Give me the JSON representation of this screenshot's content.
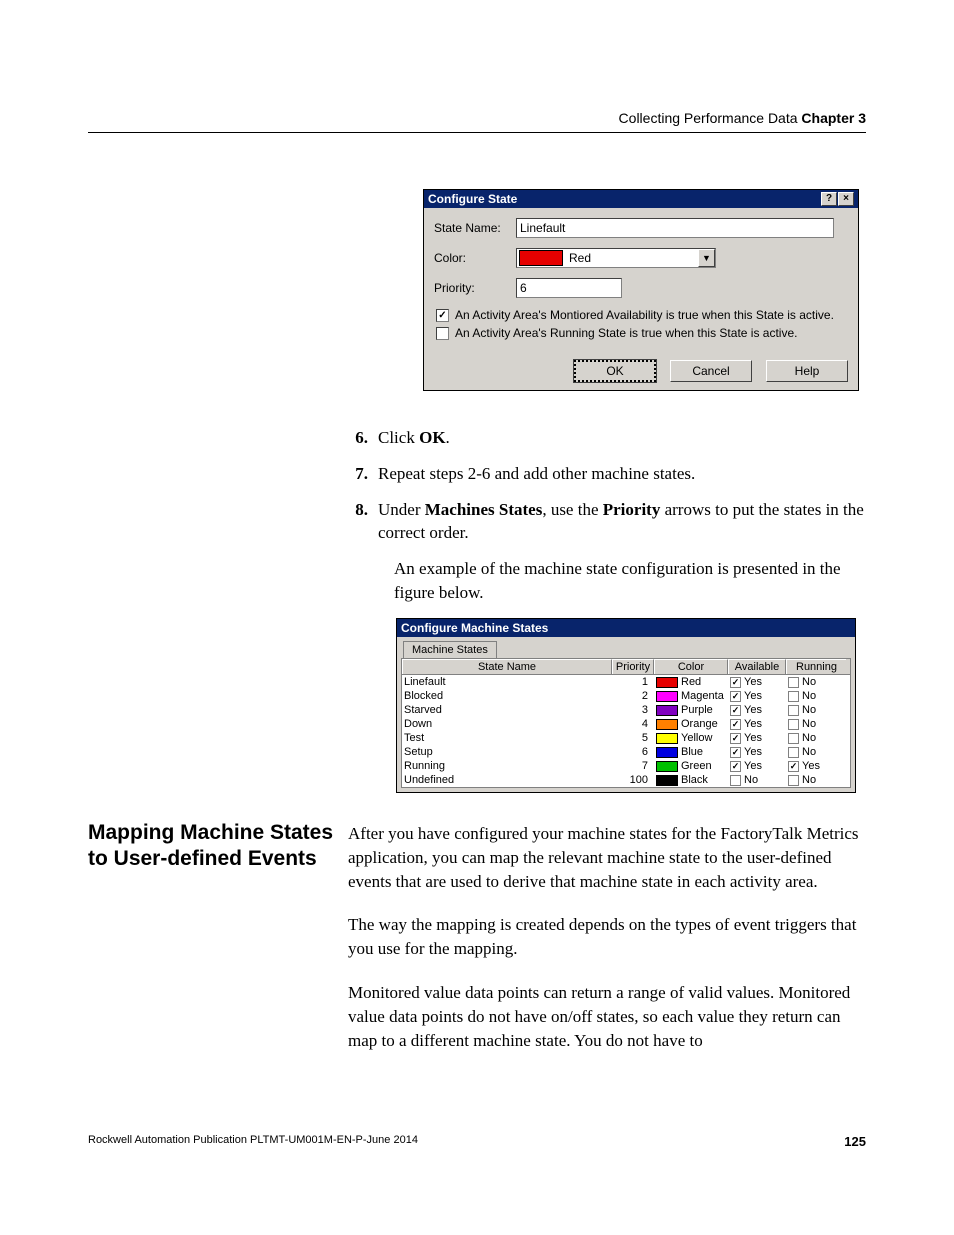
{
  "header": {
    "section": "Collecting Performance Data",
    "chapter": "Chapter 3"
  },
  "dialog1": {
    "title": "Configure State",
    "help_glyph": "?",
    "close_glyph": "×",
    "state_name_label": "State Name:",
    "state_name_value": "Linefault",
    "color_label": "Color:",
    "color_value": "Red",
    "color_swatch_hex": "#e60000",
    "dropdown_glyph": "▼",
    "priority_label": "Priority:",
    "priority_value": "6",
    "checkbox_monitored_checked": "✓",
    "checkbox_monitored_label": "An Activity Area's Montiored Availability is true when this State is active.",
    "checkbox_running_checked": "",
    "checkbox_running_label": "An Activity Area's Running State is true when this State is active.",
    "btn_ok": "OK",
    "btn_cancel": "Cancel",
    "btn_help": "Help"
  },
  "steps": {
    "s6_num": "6.",
    "s6_pre": "Click ",
    "s6_bold": "OK",
    "s6_post": ".",
    "s7_num": "7.",
    "s7_text": "Repeat steps 2-6 and add other machine states.",
    "s8_num": "8.",
    "s8_pre": "Under ",
    "s8_b1": "Machines States",
    "s8_mid": ", use the ",
    "s8_b2": "Priority",
    "s8_post": " arrows to put the states in the correct order.",
    "para_example": "An example of the machine state configuration is presented in the figure below."
  },
  "dialog2": {
    "title": "Configure Machine States",
    "tab_label": "Machine States",
    "headers": {
      "name": "State Name",
      "priority": "Priority",
      "color": "Color",
      "available": "Available",
      "running": "Running"
    },
    "rows": [
      {
        "name": "Linefault",
        "priority": "1",
        "swatch": "#e60000",
        "color": "Red",
        "avail_checked": "✓",
        "avail": "Yes",
        "run_checked": "",
        "run": "No"
      },
      {
        "name": "Blocked",
        "priority": "2",
        "swatch": "#ff00ff",
        "color": "Magenta",
        "avail_checked": "✓",
        "avail": "Yes",
        "run_checked": "",
        "run": "No"
      },
      {
        "name": "Starved",
        "priority": "3",
        "swatch": "#8000c0",
        "color": "Purple",
        "avail_checked": "✓",
        "avail": "Yes",
        "run_checked": "",
        "run": "No"
      },
      {
        "name": "Down",
        "priority": "4",
        "swatch": "#ff8000",
        "color": "Orange",
        "avail_checked": "✓",
        "avail": "Yes",
        "run_checked": "",
        "run": "No"
      },
      {
        "name": "Test",
        "priority": "5",
        "swatch": "#ffff00",
        "color": "Yellow",
        "avail_checked": "✓",
        "avail": "Yes",
        "run_checked": "",
        "run": "No"
      },
      {
        "name": "Setup",
        "priority": "6",
        "swatch": "#0000e0",
        "color": "Blue",
        "avail_checked": "✓",
        "avail": "Yes",
        "run_checked": "",
        "run": "No"
      },
      {
        "name": "Running",
        "priority": "7",
        "swatch": "#00c000",
        "color": "Green",
        "avail_checked": "✓",
        "avail": "Yes",
        "run_checked": "✓",
        "run": "Yes"
      },
      {
        "name": "Undefined",
        "priority": "100",
        "swatch": "#000000",
        "color": "Black",
        "avail_checked": "",
        "avail": "No",
        "run_checked": "",
        "run": "No"
      }
    ]
  },
  "section": {
    "heading": "Mapping Machine States to User-defined Events",
    "p1": "After you have configured your machine states for the FactoryTalk Metrics application, you can map the relevant machine state to the user-defined events that are used to derive that machine state in each activity area.",
    "p2": "The way the mapping is created depends on the types of event triggers that you use for the mapping.",
    "p3": "Monitored value data points can return a range of valid values. Monitored value data points do not have on/off states, so each value they return can map to a different machine state. You do not have to"
  },
  "footer": {
    "publication": "Rockwell Automation Publication PLTMT-UM001M-EN-P-June 2014",
    "page": "125"
  }
}
